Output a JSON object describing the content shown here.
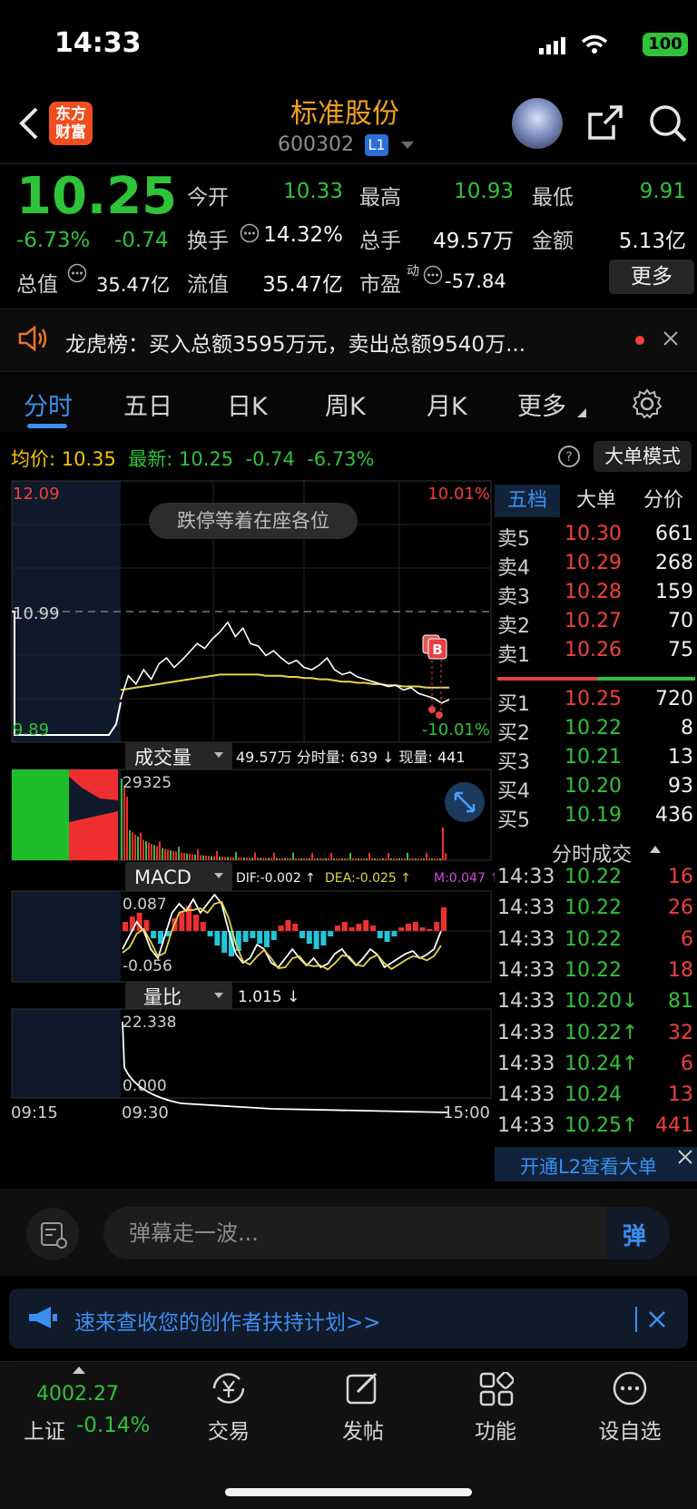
{
  "status": {
    "time": "14:33",
    "battery": "100"
  },
  "header": {
    "logo_line1": "东方",
    "logo_line2": "财富",
    "title": "标准股份",
    "code": "600302",
    "level": "L1"
  },
  "quote": {
    "price": "10.25",
    "change_pct": "-6.73%",
    "change": "-0.74",
    "open_label": "今开",
    "open": "10.33",
    "high_label": "最高",
    "high": "10.93",
    "low_label": "最低",
    "low": "9.91",
    "turnover_label": "换手",
    "turnover": "14.32%",
    "volume_label": "总手",
    "volume": "49.57万",
    "amount_label": "金额",
    "amount": "5.13亿",
    "mktcap_label": "总值",
    "mktcap": "35.47亿",
    "float_label": "流值",
    "float": "35.47亿",
    "pe_label": "市盈",
    "pe_sup": "动",
    "pe": "-57.84",
    "more": "更多"
  },
  "banner": {
    "text": "龙虎榜：买入总额3595万元，卖出总额9540万..."
  },
  "tabs": [
    "分时",
    "五日",
    "日K",
    "周K",
    "月K",
    "更多"
  ],
  "info": {
    "avg_label": "均价:",
    "avg": "10.35",
    "latest_label": "最新:",
    "latest": "10.25",
    "latest_change": "-0.74",
    "latest_pct": "-6.73%",
    "big_order_mode": "大单模式"
  },
  "chart_data": {
    "type": "line",
    "price_axis": {
      "top": "12.09",
      "mid": "10.99",
      "bottom": "9.89",
      "top_pct": "10.01%",
      "bottom_pct": "-10.01%"
    },
    "time_axis": [
      "09:15",
      "09:30",
      "15:00"
    ],
    "toast": "跌停等着在座各位",
    "prev_close": 10.99,
    "price": [
      10.25,
      10.45,
      10.38,
      10.5,
      10.42,
      10.55,
      10.6,
      10.52,
      10.58,
      10.65,
      10.72,
      10.68,
      10.76,
      10.82,
      10.9,
      10.78,
      10.85,
      10.72,
      10.7,
      10.62,
      10.66,
      10.6,
      10.55,
      10.58,
      10.52,
      10.5,
      10.54,
      10.6,
      10.5,
      10.46,
      10.48,
      10.44,
      10.42,
      10.4,
      10.38,
      10.36,
      10.37,
      10.33,
      10.35,
      10.3,
      10.28,
      10.26,
      10.22,
      10.25
    ],
    "avg": [
      10.33,
      10.34,
      10.35,
      10.36,
      10.37,
      10.38,
      10.39,
      10.4,
      10.41,
      10.42,
      10.43,
      10.44,
      10.45,
      10.46,
      10.46,
      10.46,
      10.46,
      10.46,
      10.46,
      10.45,
      10.45,
      10.45,
      10.44,
      10.44,
      10.43,
      10.43,
      10.42,
      10.42,
      10.41,
      10.4,
      10.4,
      10.39,
      10.39,
      10.38,
      10.38,
      10.37,
      10.37,
      10.36,
      10.36,
      10.36,
      10.35,
      10.35,
      10.35,
      10.35
    ],
    "volume_label": "成交量",
    "volume_info": "49.57万 分时量: 639 ↓ 现量: 441",
    "volume_max": "29325",
    "macd_label": "MACD",
    "dif": "DIF:-0.002 ↑",
    "dea": "DEA:-0.025 ↑",
    "m": "M:0.047 ↑",
    "macd_top": "0.087",
    "macd_bottom": "-0.056",
    "ratio_label": "量比",
    "ratio_value": "1.015 ↓",
    "ratio_top": "22.338",
    "ratio_bottom": "0.000"
  },
  "order_book": {
    "tabs": [
      "五档",
      "大单",
      "分价"
    ],
    "asks": [
      {
        "label": "卖5",
        "price": "10.30",
        "vol": "661"
      },
      {
        "label": "卖4",
        "price": "10.29",
        "vol": "268"
      },
      {
        "label": "卖3",
        "price": "10.28",
        "vol": "159"
      },
      {
        "label": "卖2",
        "price": "10.27",
        "vol": "70"
      },
      {
        "label": "卖1",
        "price": "10.26",
        "vol": "75"
      }
    ],
    "bids": [
      {
        "label": "买1",
        "price": "10.25",
        "vol": "720"
      },
      {
        "label": "买2",
        "price": "10.22",
        "vol": "8"
      },
      {
        "label": "买3",
        "price": "10.21",
        "vol": "13"
      },
      {
        "label": "买4",
        "price": "10.20",
        "vol": "93"
      },
      {
        "label": "买5",
        "price": "10.19",
        "vol": "436"
      }
    ],
    "trades_title": "分时成交",
    "trades": [
      {
        "time": "14:33",
        "price": "10.22",
        "vol": "16",
        "pc": "#2fc33a",
        "vc": "#f0403b"
      },
      {
        "time": "14:33",
        "price": "10.22",
        "vol": "26",
        "pc": "#2fc33a",
        "vc": "#f0403b"
      },
      {
        "time": "14:33",
        "price": "10.22",
        "vol": "6",
        "pc": "#2fc33a",
        "vc": "#f0403b"
      },
      {
        "time": "14:33",
        "price": "10.22",
        "vol": "18",
        "pc": "#2fc33a",
        "vc": "#f0403b"
      },
      {
        "time": "14:33",
        "price": "10.20↓",
        "vol": "81",
        "pc": "#2fc33a",
        "vc": "#2fc33a"
      },
      {
        "time": "14:33",
        "price": "10.22↑",
        "vol": "32",
        "pc": "#2fc33a",
        "vc": "#f0403b"
      },
      {
        "time": "14:33",
        "price": "10.24↑",
        "vol": "6",
        "pc": "#2fc33a",
        "vc": "#f0403b"
      },
      {
        "time": "14:33",
        "price": "10.24",
        "vol": "13",
        "pc": "#2fc33a",
        "vc": "#f0403b"
      },
      {
        "time": "14:33",
        "price": "10.25↑",
        "vol": "441",
        "pc": "#2fc33a",
        "vc": "#f0403b"
      }
    ],
    "l2_banner": "开通L2查看大单"
  },
  "comment": {
    "placeholder": "弹幕走一波...",
    "danmu_btn": "弹"
  },
  "promo": {
    "text": "速来查收您的创作者扶持计划>>"
  },
  "bottom_nav": {
    "index_value": "4002.27",
    "index_name": "上证",
    "index_pct": "-0.14%",
    "items": [
      "交易",
      "发帖",
      "功能",
      "设自选"
    ]
  },
  "colors": {
    "up": "#f0403b",
    "down": "#2fc33a",
    "accent": "#3a8ff0",
    "brand": "#f5a01a"
  }
}
